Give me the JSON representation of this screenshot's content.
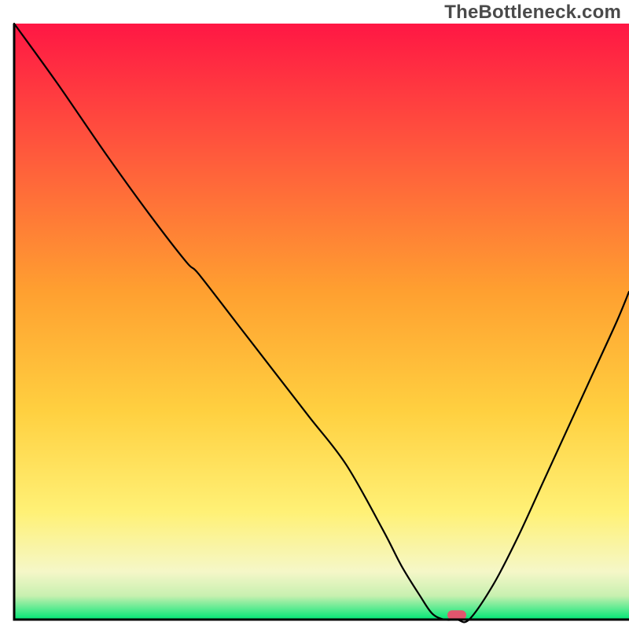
{
  "watermark": "TheBottleneck.com",
  "colors": {
    "gradient_top": "#ff1744",
    "gradient_mid_upper": "#ff6d3a",
    "gradient_mid": "#ffb030",
    "gradient_mid_lower": "#ffe030",
    "gradient_yellow": "#fff176",
    "gradient_pale": "#f7f7c0",
    "gradient_green": "#00e676",
    "axis": "#000000",
    "curve": "#000000",
    "marker": "#e2556d"
  },
  "chart_data": {
    "type": "line",
    "title": "",
    "xlabel": "",
    "ylabel": "",
    "xlim": [
      0,
      100
    ],
    "ylim": [
      0,
      100
    ],
    "x": [
      0,
      7,
      15,
      22,
      28,
      30,
      36,
      42,
      48,
      54,
      60,
      63,
      66,
      68,
      70,
      72,
      74,
      78,
      82,
      86,
      90,
      94,
      98,
      100
    ],
    "y": [
      100,
      90,
      78,
      68,
      60,
      58,
      50,
      42,
      34,
      26,
      15,
      9,
      4,
      1,
      0,
      0,
      0,
      6,
      14,
      23,
      32,
      41,
      50,
      55
    ],
    "marker": {
      "x": 72,
      "y": 0.5
    },
    "annotations": []
  }
}
